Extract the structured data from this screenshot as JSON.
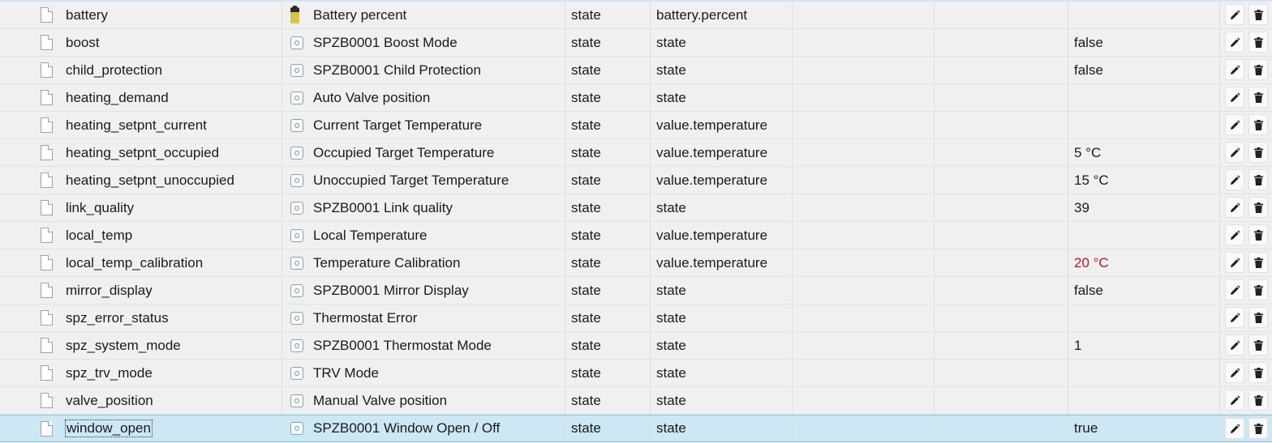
{
  "rows": [
    {
      "id": "battery",
      "name": "Battery percent",
      "type": "state",
      "role": "battery.percent",
      "value": "",
      "icon": "battery-icon"
    },
    {
      "id": "boost",
      "name": "SPZB0001 Boost Mode",
      "type": "state",
      "role": "state",
      "value": "false",
      "icon": "state-icon"
    },
    {
      "id": "child_protection",
      "name": "SPZB0001 Child Protection",
      "type": "state",
      "role": "state",
      "value": "false",
      "icon": "state-icon"
    },
    {
      "id": "heating_demand",
      "name": "Auto Valve position",
      "type": "state",
      "role": "state",
      "value": "",
      "icon": "state-icon"
    },
    {
      "id": "heating_setpnt_current",
      "name": "Current Target Temperature",
      "type": "state",
      "role": "value.temperature",
      "value": "",
      "icon": "state-icon"
    },
    {
      "id": "heating_setpnt_occupied",
      "name": "Occupied Target Temperature",
      "type": "state",
      "role": "value.temperature",
      "value": "5 °C",
      "icon": "state-icon"
    },
    {
      "id": "heating_setpnt_unoccupied",
      "name": "Unoccupied Target Temperature",
      "type": "state",
      "role": "value.temperature",
      "value": "15 °C",
      "icon": "state-icon"
    },
    {
      "id": "link_quality",
      "name": "SPZB0001 Link quality",
      "type": "state",
      "role": "state",
      "value": "39",
      "icon": "state-icon"
    },
    {
      "id": "local_temp",
      "name": "Local Temperature",
      "type": "state",
      "role": "value.temperature",
      "value": "",
      "icon": "state-icon"
    },
    {
      "id": "local_temp_calibration",
      "name": "Temperature Calibration",
      "type": "state",
      "role": "value.temperature",
      "value": "20 °C",
      "value_color": "#b21818",
      "icon": "state-icon"
    },
    {
      "id": "mirror_display",
      "name": "SPZB0001 Mirror Display",
      "type": "state",
      "role": "state",
      "value": "false",
      "icon": "state-icon"
    },
    {
      "id": "spz_error_status",
      "name": "Thermostat Error",
      "type": "state",
      "role": "state",
      "value": "",
      "icon": "state-icon"
    },
    {
      "id": "spz_system_mode",
      "name": "SPZB0001 Thermostat Mode",
      "type": "state",
      "role": "state",
      "value": "1",
      "icon": "state-icon"
    },
    {
      "id": "spz_trv_mode",
      "name": "TRV Mode",
      "type": "state",
      "role": "state",
      "value": "",
      "icon": "state-icon"
    },
    {
      "id": "valve_position",
      "name": "Manual Valve position",
      "type": "state",
      "role": "state",
      "value": "",
      "icon": "state-icon"
    },
    {
      "id": "window_open",
      "name": "SPZB0001 Window Open / Off",
      "type": "state",
      "role": "state",
      "value": "true",
      "icon": "state-icon",
      "selected": true
    }
  ],
  "row_icons": {
    "file": "document-icon",
    "edit": "pencil-icon",
    "delete": "trash-icon"
  },
  "colors": {
    "selected_row": "#cce8f4",
    "background": "#f0f0f0",
    "warning_value": "#b21818"
  }
}
